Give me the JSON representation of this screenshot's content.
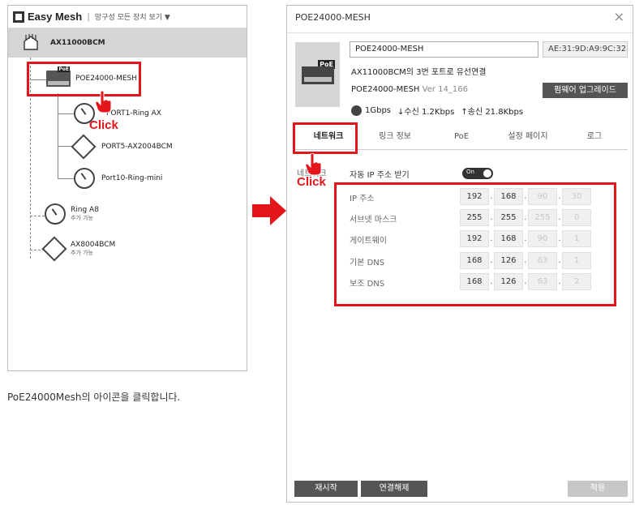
{
  "left_panel": {
    "app_title": "Easy Mesh",
    "separator": "|",
    "view_all": "망구성 모든 장치 보기 ▼",
    "root": {
      "label": "AX11000BCM"
    },
    "nodes": [
      {
        "label": "POE24000-MESH"
      },
      {
        "label": "PORT1-Ring AX"
      },
      {
        "label": "PORT5-AX2004BCM"
      },
      {
        "label": "Port10-Ring-mini"
      },
      {
        "label": "Ring A8",
        "sub": "추가 가능"
      },
      {
        "label": "AX8004BCM",
        "sub": "추가 가능"
      }
    ],
    "click_label": "Click",
    "poe_tag": "PoE"
  },
  "caption": "PoE24000Mesh의 아이콘을 클릭합니다.",
  "dialog": {
    "title": "POE24000-MESH",
    "close": "×",
    "poe_tag": "PoE",
    "name_value": "POE24000-MESH",
    "mac": "AE:31:9D:A9:9C:32",
    "connection": "AX11000BCM의 3번 포트로 유선연결",
    "model": "POE24000-MESH",
    "version": "Ver 14_166",
    "firmware_button": "펌웨어 업그레이드",
    "stats": {
      "speed": "1Gbps",
      "rx": "↓수신 1.2Kbps",
      "tx": "↑송신 21.8Kbps"
    },
    "tabs": [
      {
        "label": "네트워크"
      },
      {
        "label": "링크 정보"
      },
      {
        "label": "PoE"
      },
      {
        "label": "설정 페이지"
      },
      {
        "label": "로그"
      }
    ],
    "click_label": "Click",
    "network_label": "네트워크",
    "auto_ip_label": "자동 IP 주소 받기",
    "toggle_text": "On",
    "fields": [
      {
        "label": "IP 주소",
        "octets": [
          "192",
          "168",
          "90",
          "30"
        ]
      },
      {
        "label": "서브넷 마스크",
        "octets": [
          "255",
          "255",
          "255",
          "0"
        ]
      },
      {
        "label": "게이트웨이",
        "octets": [
          "192",
          "168",
          "90",
          "1"
        ]
      },
      {
        "label": "기본 DNS",
        "octets": [
          "168",
          "126",
          "63",
          "1"
        ]
      },
      {
        "label": "보조 DNS",
        "octets": [
          "168",
          "126",
          "63",
          "2"
        ]
      }
    ],
    "buttons": {
      "restart": "재시작",
      "disconnect": "연결해제",
      "apply": "적용"
    }
  },
  "colors": {
    "highlight": "#e3151a",
    "dark_button": "#555555",
    "disabled_button": "#c7c7c7"
  }
}
